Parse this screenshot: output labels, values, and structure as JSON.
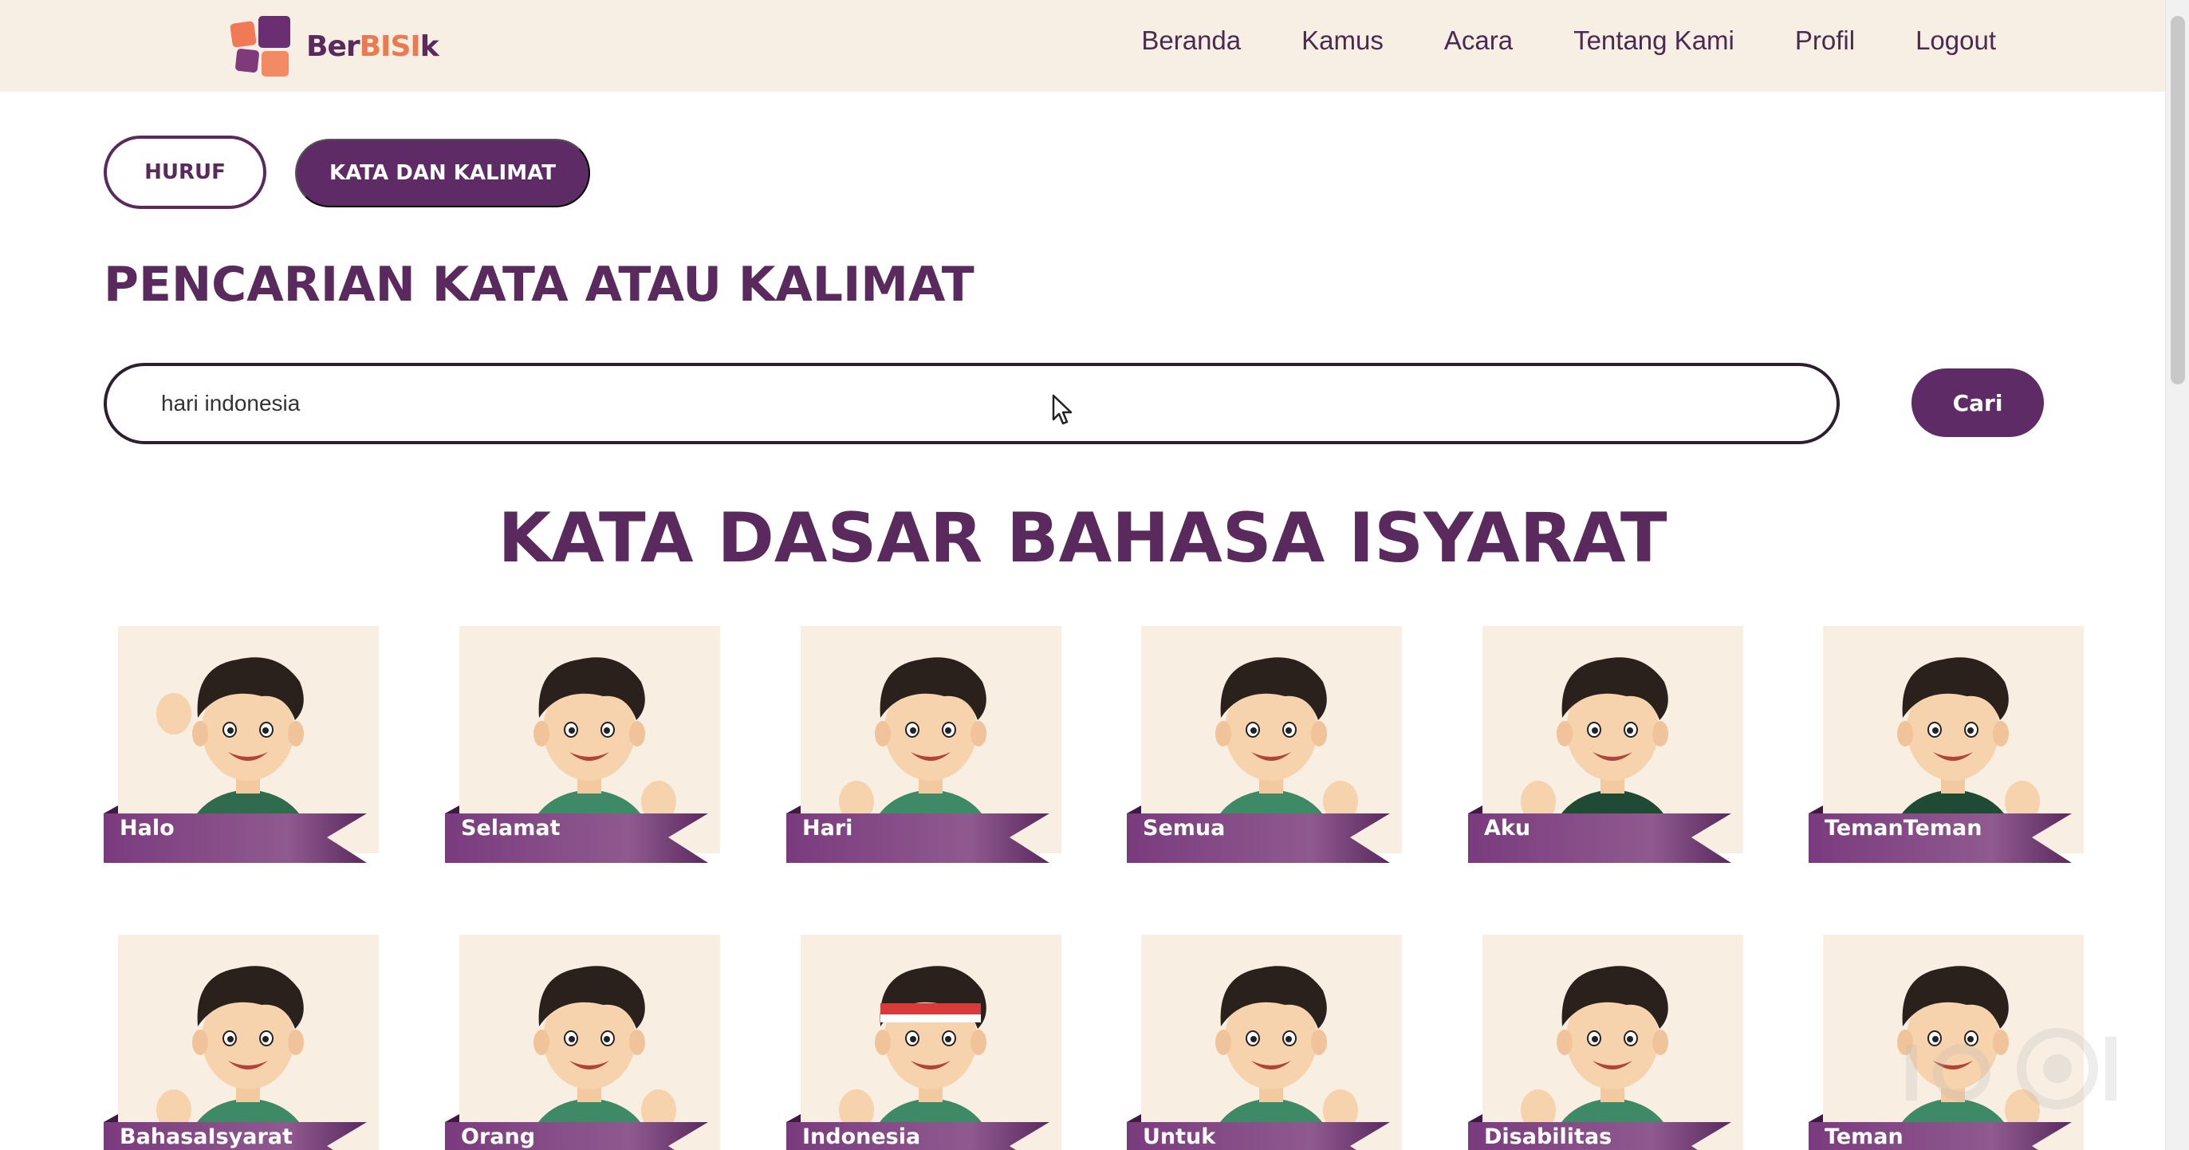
{
  "header": {
    "logo_prefix": "Ber",
    "logo_accent": "BISI",
    "logo_suffix": "k",
    "nav": [
      {
        "label": "Beranda"
      },
      {
        "label": "Kamus"
      },
      {
        "label": "Acara"
      },
      {
        "label": "Tentang Kami"
      },
      {
        "label": "Profil"
      },
      {
        "label": "Logout"
      }
    ]
  },
  "tabs": {
    "huruf": "HURUF",
    "kata": "KATA DAN KALIMAT"
  },
  "search": {
    "title": "PENCARIAN KATA ATAU KALIMAT",
    "value": "hari indonesia",
    "button": "Cari"
  },
  "section": {
    "title": "KATA DASAR BAHASA ISYARAT"
  },
  "cards_row1": [
    "Halo",
    "Selamat",
    "Hari",
    "Semua",
    "Aku",
    "TemanTeman"
  ],
  "cards_row2": [
    "BahasaIsyarat",
    "Orang",
    "Indonesia",
    "Untuk",
    "Disabilitas",
    "Teman"
  ],
  "colors": {
    "primary": "#5f2b66",
    "header_bg": "#f7efe4",
    "card_bg": "#f8eee2",
    "accent": "#e97a52"
  }
}
